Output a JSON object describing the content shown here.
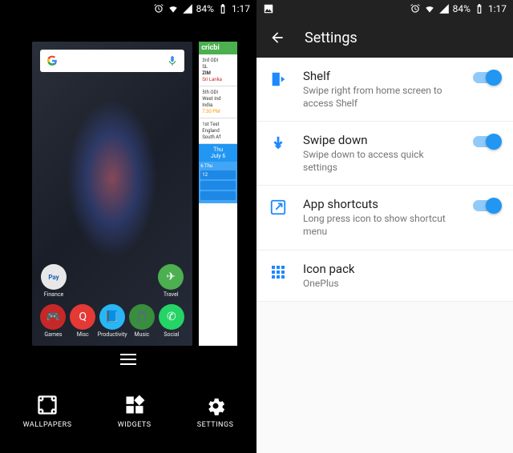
{
  "statusbar": {
    "battery": "84%",
    "time": "1:17"
  },
  "launcher": {
    "apps_row1": [
      {
        "label": "Finance",
        "cls": "ai-finance",
        "glyph": "Pay"
      },
      {
        "label": "Travel",
        "cls": "ai-travel",
        "glyph": "✈"
      }
    ],
    "apps_row2": [
      {
        "label": "Games",
        "cls": "ai-games",
        "glyph": "🎮"
      },
      {
        "label": "Misc",
        "cls": "ai-misc",
        "glyph": "Q"
      },
      {
        "label": "Productivity",
        "cls": "ai-prod",
        "glyph": "📘"
      },
      {
        "label": "Music",
        "cls": "ai-music",
        "glyph": "🎵"
      },
      {
        "label": "Social",
        "cls": "ai-social",
        "glyph": "✆"
      }
    ],
    "actions": {
      "wallpapers": "WALLPAPERS",
      "widgets": "WIDGETS",
      "settings": "SETTINGS"
    },
    "widget": {
      "cric_title": "cricbi",
      "match1_head": "3rd ODI",
      "match1_team1": "SL",
      "match1_team2": "ZIM",
      "match1_note": "Sri Lanka",
      "match2_head": "5th ODI",
      "match2_team1": "West Ind",
      "match2_team2": "India",
      "match2_note": "7:30 PM",
      "match3_head": "1st Test",
      "match3_team1": "England",
      "match3_team2": "South Af",
      "cal_head1": "Thu",
      "cal_head2": "July 6",
      "cal_day": "6",
      "cal_dow": "Thu"
    }
  },
  "settings": {
    "title": "Settings",
    "items": [
      {
        "id": "shelf",
        "title": "Shelf",
        "sub": "Swipe right from home screen to access Shelf",
        "toggle": true
      },
      {
        "id": "swipe-down",
        "title": "Swipe down",
        "sub": "Swipe down to access quick settings",
        "toggle": true
      },
      {
        "id": "app-shortcuts",
        "title": "App shortcuts",
        "sub": "Long press icon to show shortcut menu",
        "toggle": true
      },
      {
        "id": "icon-pack",
        "title": "Icon pack",
        "sub": "OnePlus",
        "toggle": false
      }
    ]
  }
}
